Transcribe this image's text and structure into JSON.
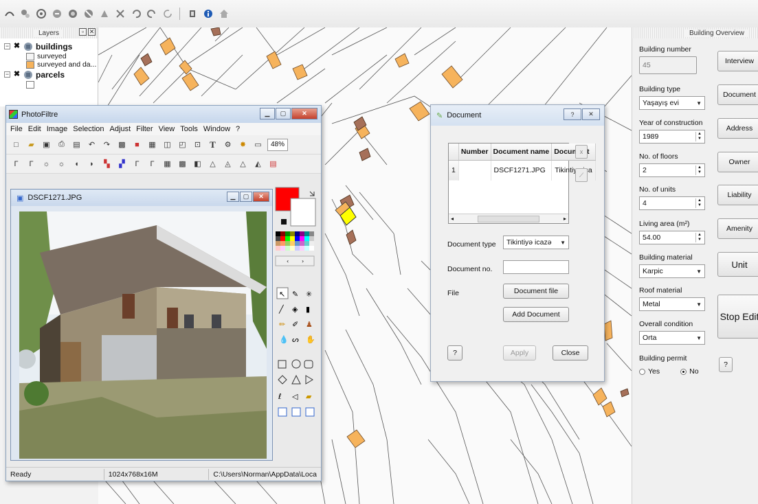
{
  "toolbar": {
    "icons": [
      "curve-icon",
      "node-tool-icon",
      "rotate-icon",
      "polygon-icon",
      "merge-icon",
      "split-icon",
      "tool-icon",
      "tool-icon",
      "undo-icon",
      "redo-icon",
      "refresh-icon",
      "scale-icon",
      "info-icon",
      "home-icon"
    ]
  },
  "layers": {
    "title": "Layers",
    "items": [
      {
        "name": "buildings",
        "children": [
          {
            "label": "surveyed",
            "color": "#f5f5f5"
          },
          {
            "label": "surveyed and da...",
            "color": "#f6b35c"
          }
        ]
      },
      {
        "name": "parcels",
        "children": [
          {
            "label": "",
            "color": "#ffffff"
          }
        ]
      }
    ]
  },
  "photofiltre": {
    "title": "PhotoFiltre",
    "menu": [
      "File",
      "Edit",
      "Image",
      "Selection",
      "Adjust",
      "Filter",
      "View",
      "Tools",
      "Window",
      "?"
    ],
    "zoom": "48%",
    "image_title": "DSCF1271.JPG",
    "status": {
      "state": "Ready",
      "info": "1024x768x16M",
      "path": "C:\\Users\\Norman\\AppData\\Loca"
    },
    "fg_color": "#ff0000",
    "bg_color": "#ffffff"
  },
  "document_dialog": {
    "title": "Document",
    "help": "?",
    "close_x": "✕",
    "table": {
      "columns": [
        "Number",
        "Document name",
        "Document"
      ],
      "rows": [
        {
          "row": "1",
          "number": "",
          "name": "DSCF1271.JPG",
          "doc": "Tikintiyə ica"
        }
      ]
    },
    "remove_btn": "x",
    "doc_type_label": "Document type",
    "doc_type_value": "Tikintiyə icazə",
    "doc_no_label": "Document no.",
    "doc_no_value": "",
    "file_label": "File",
    "document_file_btn": "Document file",
    "add_document_btn": "Add Document",
    "help_btn": "?",
    "apply_btn": "Apply",
    "close_btn": "Close"
  },
  "overview": {
    "title": "Building Overview",
    "building_number": {
      "label": "Building number",
      "value": "45"
    },
    "building_type": {
      "label": "Building type",
      "value": "Yaşayış evi"
    },
    "year": {
      "label": "Year of construction",
      "value": "1989"
    },
    "floors": {
      "label": "No. of floors",
      "value": "2"
    },
    "units": {
      "label": "No. of units",
      "value": "4"
    },
    "living_area": {
      "label": "Living area (m²)",
      "value": "54.00"
    },
    "building_material": {
      "label": "Building material",
      "value": "Karpic"
    },
    "roof_material": {
      "label": "Roof material",
      "value": "Metal"
    },
    "condition": {
      "label": "Overall condition",
      "value": "Orta"
    },
    "permit": {
      "label": "Building permit",
      "yes": "Yes",
      "no": "No",
      "selected": "No"
    },
    "buttons": {
      "interview": "Interview",
      "document": "Document",
      "address": "Address",
      "owner": "Owner",
      "liability": "Liability",
      "amenity": "Amenity",
      "unit": "Unit",
      "stop_edit": "Stop Edit",
      "help": "?"
    }
  },
  "colors": {
    "building_fill": "#f6b35c",
    "building_dark": "#a67059",
    "selected": "#ffff00",
    "accent": "#c9d8ec"
  }
}
